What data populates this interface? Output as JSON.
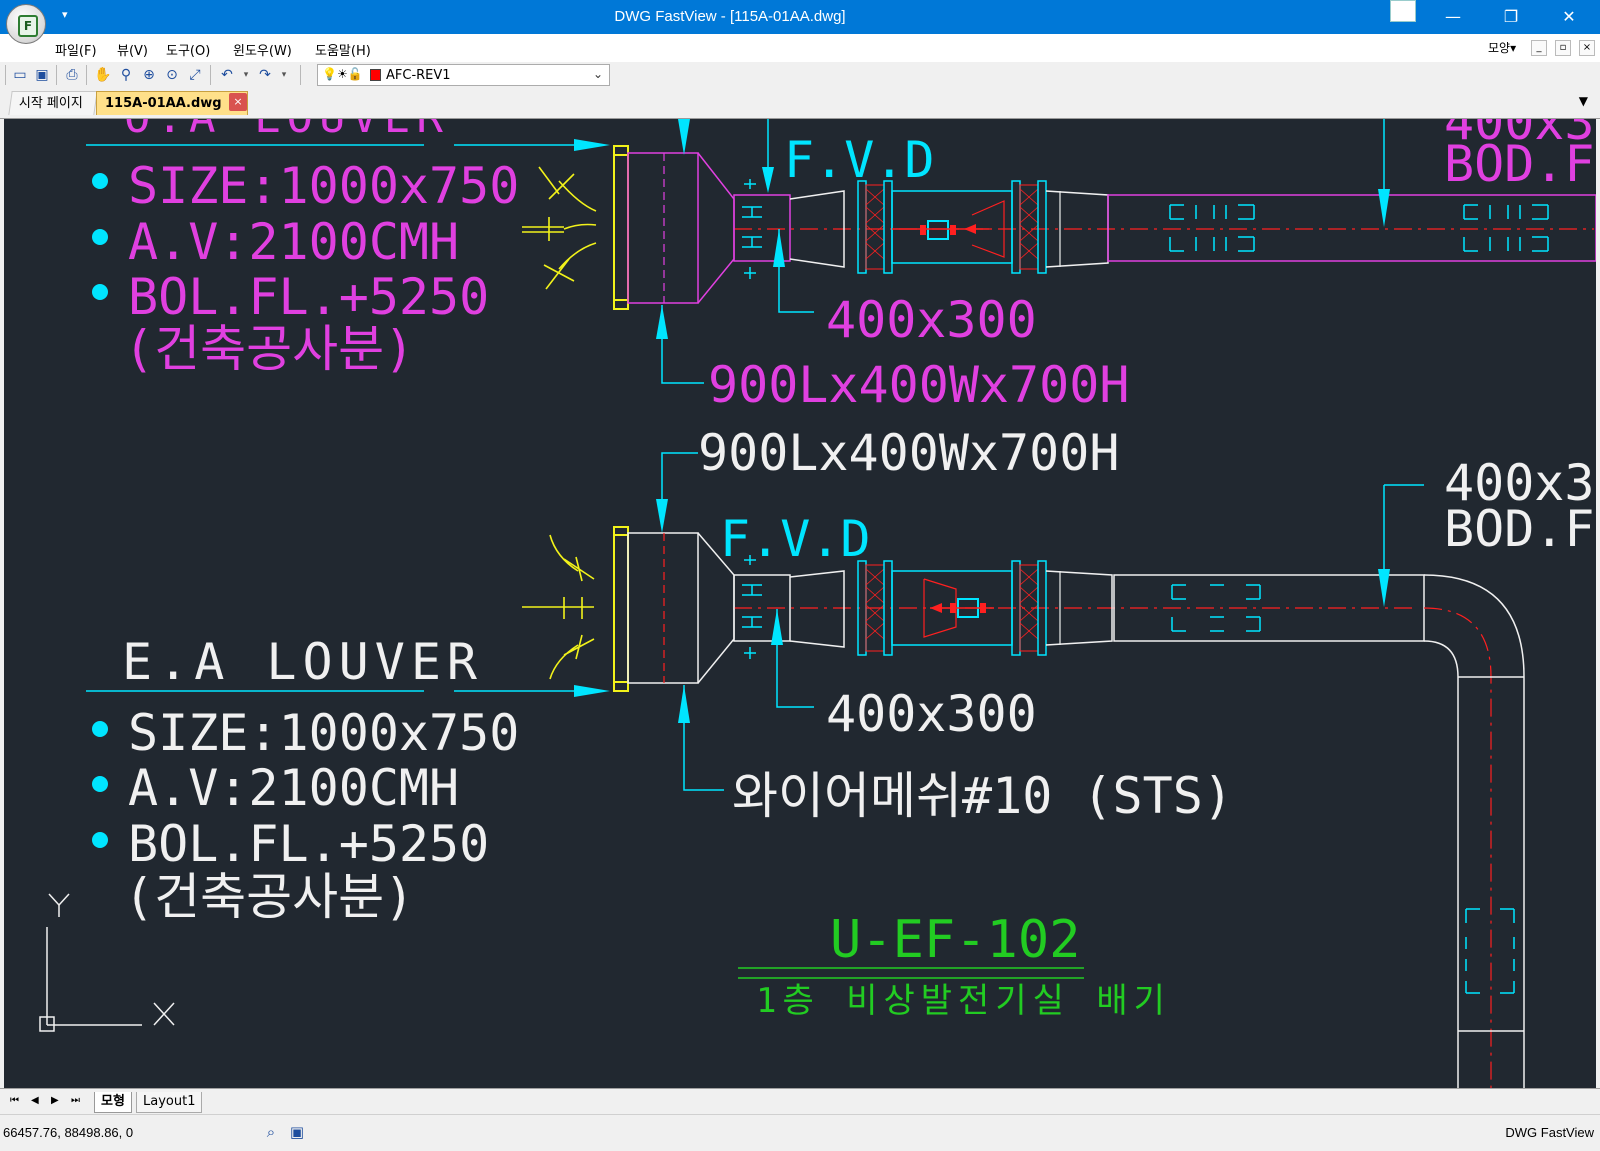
{
  "window": {
    "title": "DWG FastView - [115A-01AA.dwg]",
    "app_icon_letter": "F",
    "qat_glyph": "▾",
    "minimize": "—",
    "restore": "❐",
    "close": "✕"
  },
  "menu": {
    "items": [
      "파일(F)",
      "뷰(V)",
      "도구(O)",
      "윈도우(W)",
      "도움말(H)"
    ],
    "style_label": "모양▾",
    "mdi_min": "_",
    "mdi_restore": "▫",
    "mdi_close": "×"
  },
  "toolbar": {
    "layer_name": "AFC-REV1",
    "layer_color": "#ff0000",
    "icons": [
      "open-icon",
      "save-icon",
      "print-icon",
      "pan-icon",
      "zoom-icon",
      "zoom-in-icon",
      "zoom-window-icon",
      "zoom-extents-icon",
      "undo-icon",
      "redo-icon"
    ]
  },
  "tabs": {
    "start": "시작 페이지",
    "active": "115A-01AA.dwg",
    "close_glyph": "×",
    "menu_glyph": "▼"
  },
  "drawing": {
    "background": "#212830",
    "top": {
      "louver_title_partial": "O.A LOUVER",
      "specs": [
        "SIZE:1000x750",
        "A.V:2100CMH",
        "BOL.FL.+5250",
        "(건축공사분)"
      ],
      "fvd": "F.V.D",
      "duct_size": "400x300",
      "plenum": "900Lx400Wx700H",
      "right_label_1": "400x3",
      "right_label_2": "BOD.F"
    },
    "bottom": {
      "plenum": "900Lx400Wx700H",
      "fvd": "F.V.D",
      "louver_title": "E.A LOUVER",
      "specs": [
        "SIZE:1000x750",
        "A.V:2100CMH",
        "BOL.FL.+5250",
        "(건축공사분)"
      ],
      "duct_size": "400x300",
      "mesh": "와이어메쉬#10 (STS)",
      "right_label_1": "400x3",
      "right_label_2": "BOD.F",
      "equipment_tag": "U-EF-102",
      "equipment_desc": "1층 비상발전기실 배기"
    },
    "ucs_y": "Y",
    "ucs_x": "X",
    "colors": {
      "magenta": "#e040e0",
      "cyan": "#00e5ff",
      "white": "#f0f0f0",
      "yellow": "#f2f21a",
      "red": "#ff2020",
      "green": "#22cc22"
    }
  },
  "layout_tabs": {
    "nav": [
      "⏮",
      "◀",
      "▶",
      "⏭"
    ],
    "model": "모형",
    "layout1": "Layout1"
  },
  "status": {
    "coords": "66457.76, 88498.86, 0",
    "app_name": "DWG FastView"
  }
}
